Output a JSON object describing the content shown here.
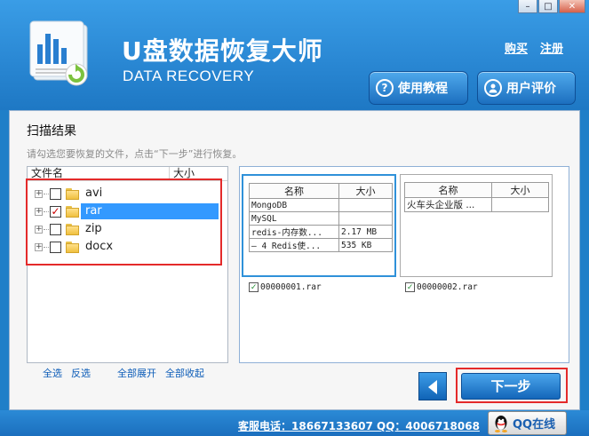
{
  "header": {
    "title": "U盘数据恢复大师",
    "subtitle": "DATA RECOVERY",
    "links": {
      "buy": "购买",
      "register": "注册"
    },
    "help_button": "使用教程",
    "review_button": "用户评价",
    "window_controls": {
      "minimize": "–",
      "maximize": "□",
      "close": "✕"
    }
  },
  "main": {
    "section_title": "扫描结果",
    "hint": "请勾选您要恢复的文件，点击“下一步”进行恢复。",
    "tree": {
      "columns": [
        "文件名",
        "大小"
      ],
      "items": [
        {
          "label": "avi",
          "checked": false,
          "selected": false
        },
        {
          "label": "rar",
          "checked": true,
          "selected": true
        },
        {
          "label": "zip",
          "checked": false,
          "selected": false
        },
        {
          "label": "docx",
          "checked": false,
          "selected": false
        }
      ]
    },
    "bottom_links": {
      "select_all": "全选",
      "invert": "反选",
      "expand_all": "全部展开",
      "collapse_all": "全部收起"
    },
    "previews": [
      {
        "columns": [
          "名称",
          "大小"
        ],
        "rows": [
          [
            "MongoDB",
            ""
          ],
          [
            "MySQL",
            ""
          ],
          [
            "redis-内存数...",
            "2.17 MB"
          ],
          [
            "— 4 Redis使...",
            "535 KB"
          ]
        ],
        "filename": "00000001.rar",
        "checked": true
      },
      {
        "columns": [
          "名称",
          "大小"
        ],
        "rows": [
          [
            "火车头企业版 ...",
            ""
          ]
        ],
        "filename": "00000002.rar",
        "checked": true
      }
    ],
    "next_button": "下一步"
  },
  "footer": {
    "contact": "客服电话：18667133607 QQ：4006718068",
    "qq_button": "QQ在线"
  },
  "colors": {
    "accent": "#2a88d4",
    "highlight": "#e42a2a",
    "selection": "#3399ff"
  }
}
